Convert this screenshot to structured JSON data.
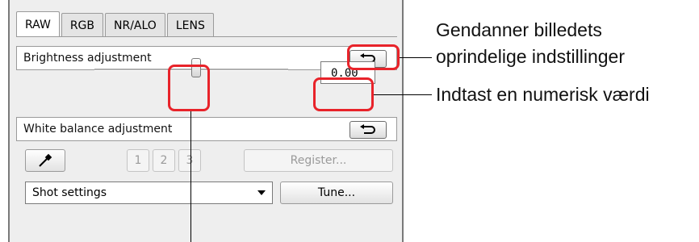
{
  "tabs": [
    "RAW",
    "RGB",
    "NR/ALO",
    "LENS"
  ],
  "active_tab": "RAW",
  "brightness": {
    "label": "Brightness adjustment",
    "value": "0.00",
    "slider_fraction": 0.5
  },
  "white_balance": {
    "label": "White balance adjustment",
    "slots": [
      "1",
      "2",
      "3"
    ],
    "register_label": "Register...",
    "selected": "Shot settings",
    "tune_label": "Tune..."
  },
  "icons": {
    "reset": "undo-arrow-icon",
    "eyedropper": "eyedropper-icon",
    "dropdown": "chevron-down-icon"
  },
  "callouts": {
    "reset_line1": "Gendanner billedets",
    "reset_line2": "oprindelige indstillinger",
    "value_hint": "Indtast en numerisk værdi"
  },
  "colors": {
    "highlight": "#e8232a",
    "panel_bg": "#eeeeee"
  }
}
